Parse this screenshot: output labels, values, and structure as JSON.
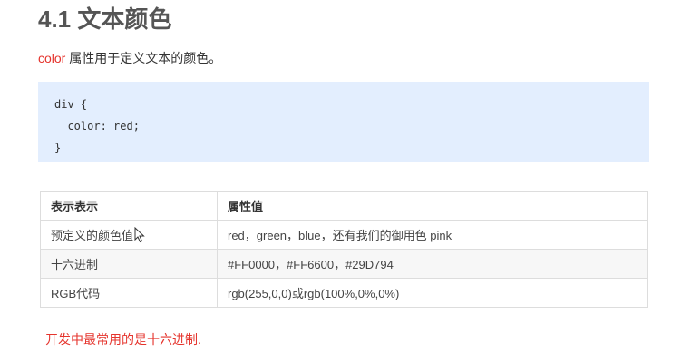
{
  "heading": "4.1 文本颜色",
  "intro": {
    "keyword": "color",
    "text": " 属性用于定义文本的颜色。"
  },
  "code": {
    "lines": [
      "div {",
      "  color: red;",
      "}"
    ]
  },
  "table": {
    "headers": [
      "表示表示",
      "属性值"
    ],
    "rows": [
      [
        "预定义的颜色值",
        "red，green，blue，还有我们的御用色 pink"
      ],
      [
        "十六进制",
        "#FF0000，#FF6600，#29D794"
      ],
      [
        "RGB代码",
        "rgb(255,0,0)或rgb(100%,0%,0%)"
      ]
    ]
  },
  "note": "开发中最常用的是十六进制.",
  "colors": {
    "accent_red": "#e5342d",
    "code_bg": "#e3eefe"
  }
}
